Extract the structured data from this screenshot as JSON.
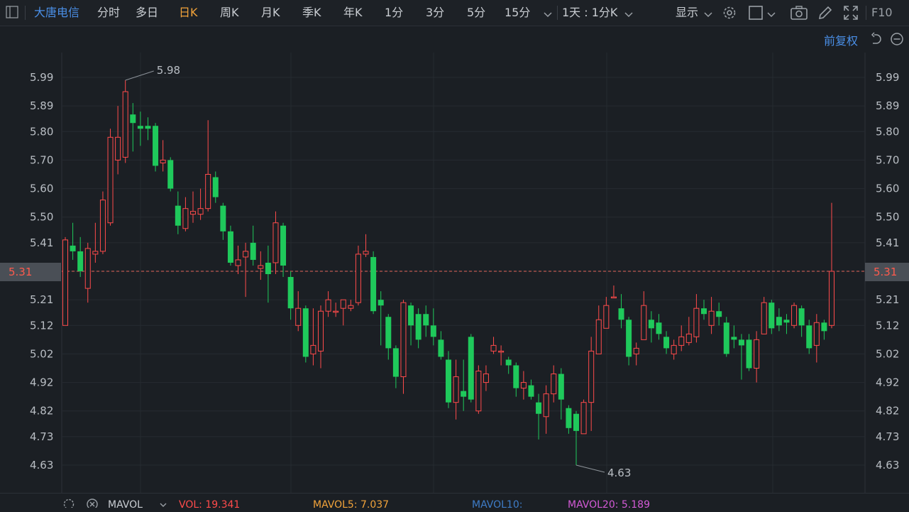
{
  "toolbar": {
    "stock_name": "大唐电信",
    "tabs": [
      {
        "label": "分时",
        "active": false
      },
      {
        "label": "多日",
        "active": false
      },
      {
        "label": "日K",
        "active": true
      },
      {
        "label": "周K",
        "active": false
      },
      {
        "label": "月K",
        "active": false
      },
      {
        "label": "季K",
        "active": false
      },
      {
        "label": "年K",
        "active": false
      },
      {
        "label": "1分",
        "active": false
      },
      {
        "label": "3分",
        "active": false
      },
      {
        "label": "5分",
        "active": false
      },
      {
        "label": "15分",
        "active": false
      }
    ],
    "period_select": "1天 : 1分K",
    "display_label": "显示",
    "f10_label": "F10",
    "icons": [
      "panel-toggle-icon",
      "chevron-down-icon",
      "gear-icon",
      "square-icon",
      "camera-icon",
      "pencil-icon",
      "fullscreen-icon"
    ]
  },
  "subbar": {
    "adjust_label": "前复权"
  },
  "chart_data": {
    "type": "candlestick",
    "y_ticks": [
      "5.99",
      "5.89",
      "5.80",
      "5.70",
      "5.60",
      "5.50",
      "5.41",
      "5.31",
      "5.21",
      "5.12",
      "5.02",
      "4.92",
      "4.82",
      "4.73",
      "4.63"
    ],
    "ylim": [
      4.63,
      5.99
    ],
    "current_price": "5.31",
    "high_annotation": "5.98",
    "low_annotation": "4.63",
    "up_color": "#ff4b4b",
    "down_color": "#1fc95b",
    "candles": [
      [
        5.12,
        5.42,
        5.43,
        5.12
      ],
      [
        5.4,
        5.38,
        5.48,
        5.35
      ],
      [
        5.38,
        5.31,
        5.43,
        5.29
      ],
      [
        5.25,
        5.39,
        5.41,
        5.2
      ],
      [
        5.37,
        5.38,
        5.48,
        5.34
      ],
      [
        5.38,
        5.56,
        5.59,
        5.37
      ],
      [
        5.48,
        5.78,
        5.81,
        5.47
      ],
      [
        5.7,
        5.78,
        5.89,
        5.65
      ],
      [
        5.71,
        5.94,
        5.98,
        5.69
      ],
      [
        5.86,
        5.83,
        5.9,
        5.73
      ],
      [
        5.82,
        5.81,
        5.87,
        5.75
      ],
      [
        5.82,
        5.81,
        5.85,
        5.77
      ],
      [
        5.82,
        5.68,
        5.83,
        5.66
      ],
      [
        5.69,
        5.7,
        5.77,
        5.66
      ],
      [
        5.7,
        5.6,
        5.71,
        5.59
      ],
      [
        5.54,
        5.47,
        5.59,
        5.44
      ],
      [
        5.46,
        5.53,
        5.57,
        5.45
      ],
      [
        5.51,
        5.52,
        5.59,
        5.48
      ],
      [
        5.51,
        5.53,
        5.6,
        5.49
      ],
      [
        5.53,
        5.65,
        5.84,
        5.52
      ],
      [
        5.64,
        5.57,
        5.66,
        5.55
      ],
      [
        5.54,
        5.45,
        5.55,
        5.42
      ],
      [
        5.45,
        5.34,
        5.47,
        5.33
      ],
      [
        5.33,
        5.35,
        5.4,
        5.3
      ],
      [
        5.36,
        5.38,
        5.41,
        5.22
      ],
      [
        5.41,
        5.35,
        5.47,
        5.33
      ],
      [
        5.32,
        5.33,
        5.38,
        5.28
      ],
      [
        5.34,
        5.3,
        5.4,
        5.2
      ],
      [
        5.34,
        5.48,
        5.52,
        5.3
      ],
      [
        5.47,
        5.33,
        5.48,
        5.29
      ],
      [
        5.29,
        5.18,
        5.31,
        5.14
      ],
      [
        5.12,
        5.18,
        5.24,
        5.1
      ],
      [
        5.18,
        5.01,
        5.19,
        4.99
      ],
      [
        5.02,
        5.05,
        5.18,
        4.98
      ],
      [
        5.03,
        5.17,
        5.19,
        4.97
      ],
      [
        5.17,
        5.21,
        5.24,
        5.15
      ],
      [
        5.17,
        5.17,
        5.2,
        5.15
      ],
      [
        5.18,
        5.21,
        5.21,
        5.12
      ],
      [
        5.18,
        5.19,
        5.21,
        5.17
      ],
      [
        5.2,
        5.37,
        5.4,
        5.19
      ],
      [
        5.37,
        5.38,
        5.44,
        5.36
      ],
      [
        5.36,
        5.17,
        5.38,
        5.16
      ],
      [
        5.21,
        5.19,
        5.24,
        5.05
      ],
      [
        5.15,
        5.04,
        5.16,
        5.0
      ],
      [
        5.04,
        4.94,
        5.05,
        4.9
      ],
      [
        4.94,
        5.2,
        5.21,
        4.88
      ],
      [
        5.19,
        5.12,
        5.2,
        5.05
      ],
      [
        5.16,
        5.07,
        5.18,
        5.04
      ],
      [
        5.16,
        5.12,
        5.19,
        5.08
      ],
      [
        5.12,
        5.08,
        5.18,
        5.05
      ],
      [
        5.07,
        5.01,
        5.1,
        5.0
      ],
      [
        5.0,
        4.85,
        5.03,
        4.83
      ],
      [
        4.85,
        4.94,
        5.0,
        4.79
      ],
      [
        4.89,
        4.87,
        5.0,
        4.82
      ],
      [
        5.08,
        4.86,
        5.09,
        4.85
      ],
      [
        4.82,
        4.96,
        4.98,
        4.81
      ],
      [
        4.92,
        4.95,
        4.98,
        4.89
      ],
      [
        5.03,
        5.05,
        5.08,
        5.02
      ],
      [
        5.03,
        5.03,
        5.05,
        4.98
      ],
      [
        5.0,
        4.98,
        5.01,
        4.95
      ],
      [
        4.98,
        4.9,
        4.99,
        4.87
      ],
      [
        4.9,
        4.92,
        4.96,
        4.86
      ],
      [
        4.91,
        4.87,
        4.93,
        4.86
      ],
      [
        4.85,
        4.81,
        4.88,
        4.72
      ],
      [
        4.8,
        4.88,
        4.91,
        4.74
      ],
      [
        4.88,
        4.95,
        4.98,
        4.85
      ],
      [
        4.95,
        4.86,
        4.97,
        4.79
      ],
      [
        4.83,
        4.76,
        4.84,
        4.74
      ],
      [
        4.81,
        4.75,
        4.82,
        4.63
      ],
      [
        4.74,
        4.85,
        4.86,
        4.74
      ],
      [
        4.85,
        5.03,
        5.08,
        4.75
      ],
      [
        5.02,
        5.14,
        5.19,
        5.02
      ],
      [
        5.11,
        5.19,
        5.22,
        5.11
      ],
      [
        5.22,
        5.22,
        5.26,
        5.22
      ],
      [
        5.18,
        5.14,
        5.23,
        5.11
      ],
      [
        5.14,
        5.01,
        5.15,
        4.98
      ],
      [
        5.02,
        5.04,
        5.06,
        4.98
      ],
      [
        5.07,
        5.19,
        5.24,
        5.07
      ],
      [
        5.14,
        5.11,
        5.17,
        5.06
      ],
      [
        5.13,
        5.09,
        5.16,
        5.07
      ],
      [
        5.08,
        5.04,
        5.1,
        5.02
      ],
      [
        5.02,
        5.05,
        5.07,
        5.0
      ],
      [
        5.05,
        5.08,
        5.12,
        5.03
      ],
      [
        5.06,
        5.09,
        5.15,
        5.05
      ],
      [
        5.08,
        5.18,
        5.23,
        5.06
      ],
      [
        5.18,
        5.16,
        5.21,
        5.14
      ],
      [
        5.12,
        5.17,
        5.22,
        5.09
      ],
      [
        5.17,
        5.15,
        5.2,
        5.12
      ],
      [
        5.13,
        5.02,
        5.15,
        5.01
      ],
      [
        5.08,
        5.07,
        5.12,
        5.04
      ],
      [
        5.07,
        5.05,
        5.09,
        4.93
      ],
      [
        5.07,
        4.97,
        5.09,
        4.96
      ],
      [
        4.97,
        5.07,
        5.1,
        4.92
      ],
      [
        5.09,
        5.2,
        5.22,
        5.1
      ],
      [
        5.2,
        5.11,
        5.21,
        5.09
      ],
      [
        5.15,
        5.12,
        5.18,
        5.1
      ],
      [
        5.14,
        5.13,
        5.16,
        5.09
      ],
      [
        5.12,
        5.19,
        5.2,
        5.11
      ],
      [
        5.18,
        5.12,
        5.19,
        5.08
      ],
      [
        5.12,
        5.04,
        5.14,
        5.02
      ],
      [
        5.05,
        5.13,
        5.16,
        4.99
      ],
      [
        5.13,
        5.1,
        5.14,
        5.07
      ],
      [
        5.12,
        5.31,
        5.55,
        5.11
      ]
    ]
  },
  "volume_bar": {
    "label": "MAVOL",
    "items": [
      {
        "text": "VOL: 19.341",
        "color": "#ff4b4b"
      },
      {
        "text": "MAVOL5: 7.037",
        "color": "#f2a33a"
      },
      {
        "text": "MAVOL10:",
        "color": "#3e7cc7"
      },
      {
        "text": "MAVOL20: 5.189",
        "color": "#d35ad6"
      }
    ]
  }
}
